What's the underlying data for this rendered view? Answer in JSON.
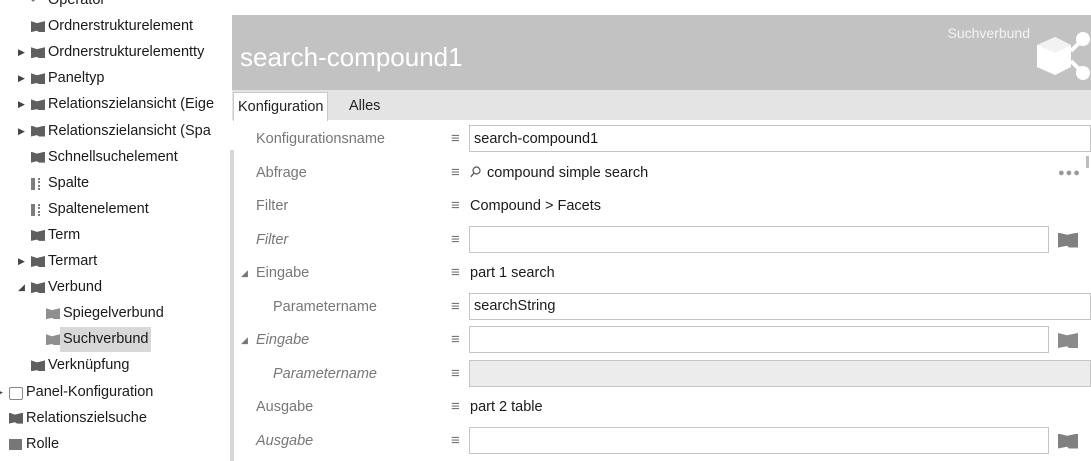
{
  "tree": {
    "items": [
      {
        "label": "Operator",
        "icon": "bullet-icon",
        "arrow": "",
        "level": 1
      },
      {
        "label": "Ordnerstrukturelement",
        "icon": "folder-icon",
        "arrow": "",
        "level": 1
      },
      {
        "label": "Ordnerstrukturelementty",
        "icon": "folder-icon",
        "arrow": "▶",
        "level": 1
      },
      {
        "label": "Paneltyp",
        "icon": "folder-icon",
        "arrow": "▶",
        "level": 1
      },
      {
        "label": "Relationszielansicht (Eige",
        "icon": "folder-icon",
        "arrow": "▶",
        "level": 1
      },
      {
        "label": "Relationszielansicht (Spa",
        "icon": "folder-icon",
        "arrow": "▶",
        "level": 1
      },
      {
        "label": "Schnellsuchelement",
        "icon": "folder-icon",
        "arrow": "",
        "level": 1
      },
      {
        "label": "Spalte",
        "icon": "column-icon",
        "arrow": "",
        "level": 1
      },
      {
        "label": "Spaltenelement",
        "icon": "column-icon",
        "arrow": "",
        "level": 1
      },
      {
        "label": "Term",
        "icon": "folder-icon",
        "arrow": "",
        "level": 1
      },
      {
        "label": "Termart",
        "icon": "folder-icon",
        "arrow": "▶",
        "level": 1
      },
      {
        "label": "Verbund",
        "icon": "folder-icon",
        "arrow": "◢",
        "level": 1
      },
      {
        "label": "Spiegelverbund",
        "icon": "folder-icon",
        "arrow": "",
        "level": 2
      },
      {
        "label": "Suchverbund",
        "icon": "folder-icon",
        "arrow": "",
        "level": 2,
        "selected": true
      },
      {
        "label": "Verknüpfung",
        "icon": "folder-icon",
        "arrow": "",
        "level": 1
      },
      {
        "label": "Panel-Konfiguration",
        "icon": "panel-icon",
        "arrow": "▶",
        "level": 0
      },
      {
        "label": "Relationszielsuche",
        "icon": "folder-icon",
        "arrow": "",
        "level": 0
      },
      {
        "label": "Rolle",
        "icon": "role-icon",
        "arrow": "",
        "level": 0
      }
    ]
  },
  "header": {
    "title": "search-compound1",
    "type_label": "Suchverbund",
    "icon": "compound-network-icon"
  },
  "tabs": [
    {
      "label": "Konfiguration",
      "active": true
    },
    {
      "label": "Alles",
      "active": false
    }
  ],
  "properties": [
    {
      "label": "Konfigurationsname",
      "kind": "input",
      "value": "search-compound1",
      "italic": false,
      "expand": ""
    },
    {
      "label": "Abfrage",
      "kind": "search",
      "value": "compound simple search",
      "italic": false,
      "expand": "",
      "extra": "more-dots-icon",
      "extra_text": "●●●"
    },
    {
      "label": "Filter",
      "kind": "text",
      "value": "Compound > Facets",
      "italic": false,
      "expand": ""
    },
    {
      "label": "Filter",
      "kind": "input",
      "value": "",
      "italic": true,
      "expand": "",
      "extra": "folder-icon"
    },
    {
      "label": "Eingabe",
      "kind": "text",
      "value": "part 1 search",
      "italic": false,
      "expand": "◢"
    },
    {
      "label": "Parametername",
      "kind": "input-wide",
      "value": "searchString",
      "italic": false,
      "expand": "",
      "indent": true
    },
    {
      "label": "Eingabe",
      "kind": "input",
      "value": "",
      "italic": true,
      "expand": "◢",
      "extra": "edit-folder-icon"
    },
    {
      "label": "Parametername",
      "kind": "input-disabled",
      "value": "",
      "italic": true,
      "expand": "",
      "indent": true
    },
    {
      "label": "Ausgabe",
      "kind": "text",
      "value": "part 2 table",
      "italic": false,
      "expand": ""
    },
    {
      "label": "Ausgabe",
      "kind": "input",
      "value": "",
      "italic": true,
      "expand": "",
      "extra": "folder-icon"
    }
  ],
  "menu_glyph": "≡",
  "colors": {
    "header_bg": "#c2c2c2",
    "tab_bar_bg": "#e4e4e4",
    "selected_bg": "#d8d8d8"
  }
}
